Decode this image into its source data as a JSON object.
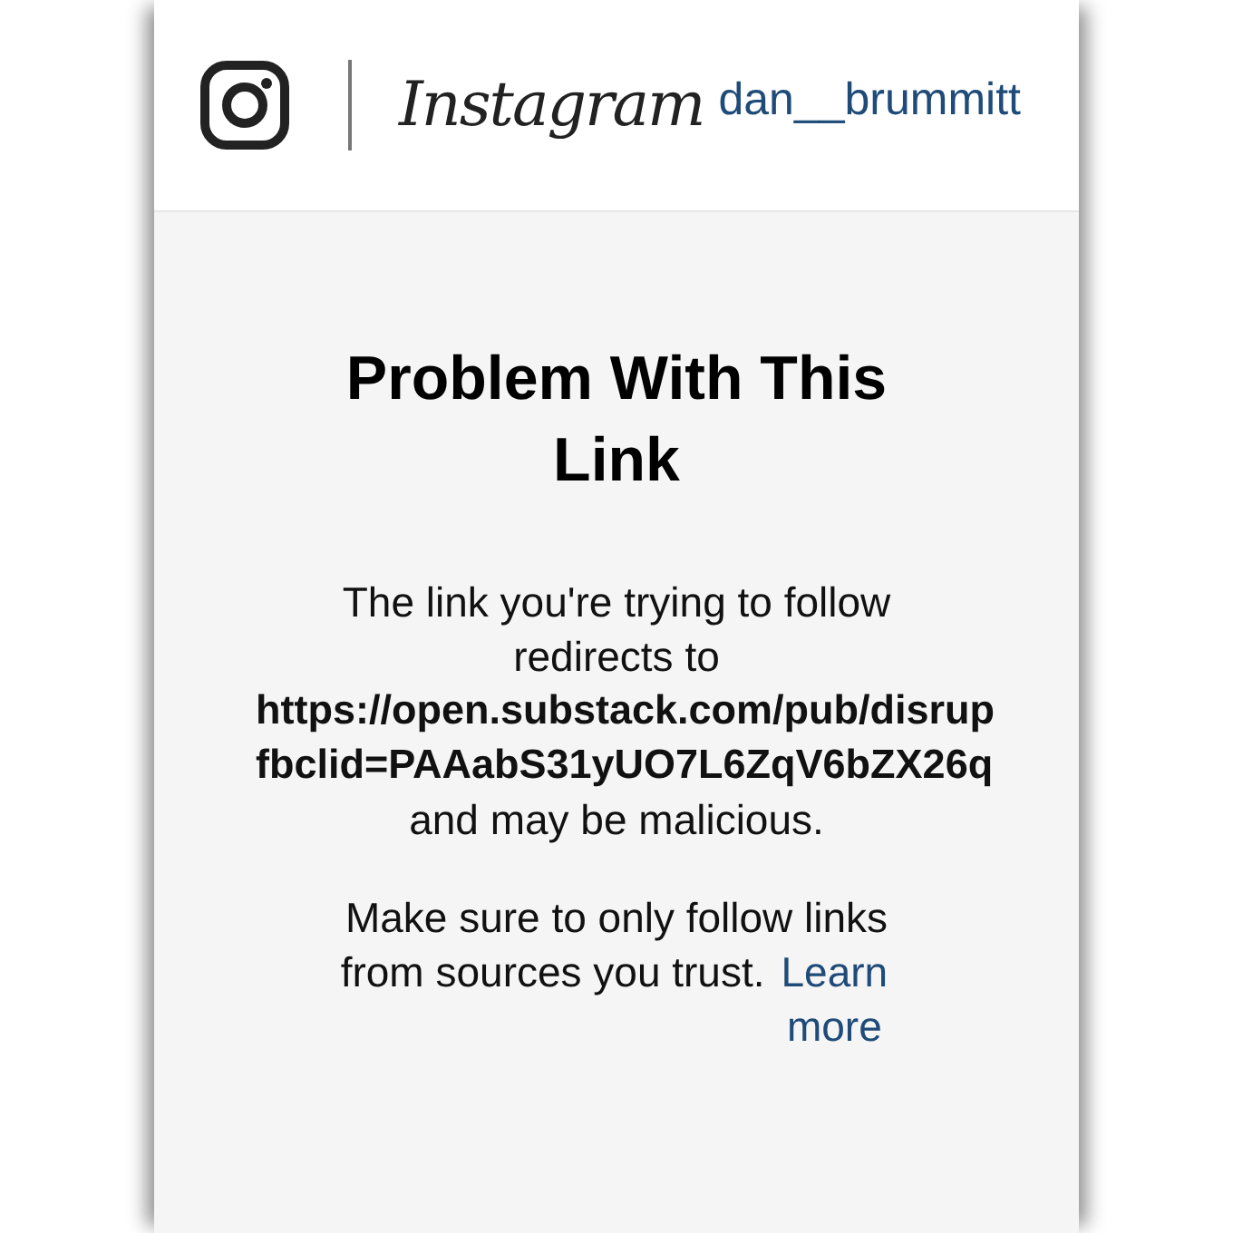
{
  "header": {
    "logo_text": "Instagram",
    "username": "dan__brummitt"
  },
  "dialog": {
    "title": "Problem With This Link",
    "message": {
      "lead": "The link you're trying to follow redirects to",
      "url_lines": [
        "https://open.substack.com/pub/disrup",
        "fbclid=PAAabS31yUO7L6ZqV6bZX26q"
      ],
      "tail": "and may be malicious."
    },
    "advice": {
      "text": "Make sure to only follow links from sources you trust.",
      "link": "Learn more"
    }
  }
}
